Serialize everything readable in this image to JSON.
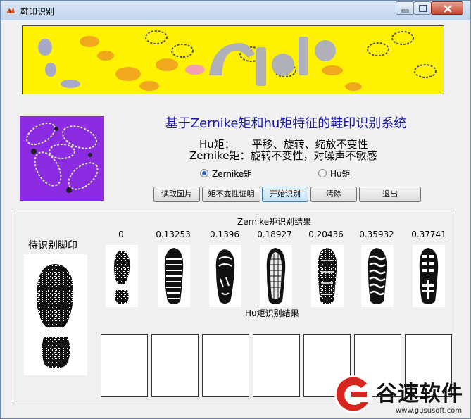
{
  "window": {
    "title": "鞋印识别"
  },
  "header": {
    "system_title": "基于Zernike矩和hu矩特征的鞋印识别系统",
    "desc_hu": "Hu矩：     平移、旋转、缩放不变性",
    "desc_zernike": "Zernike矩：旋转不变性，对噪声不敏感"
  },
  "options": {
    "zernike_label": "Zernike矩",
    "hu_label": "Hu矩",
    "selected": "Zernike矩"
  },
  "buttons": [
    {
      "label": "读取图片"
    },
    {
      "label": "矩不变性证明"
    },
    {
      "label": "开始识别"
    },
    {
      "label": "清除"
    },
    {
      "label": "退出"
    }
  ],
  "results": {
    "zernike_title": "Zernike矩识别结果",
    "hu_title": "Hu矩识别结果",
    "query_label": "待识别脚印",
    "zernike_scores": [
      "0",
      "0.13253",
      "0.1396",
      "0.18927",
      "0.20436",
      "0.35932",
      "0.37741"
    ]
  },
  "watermark": {
    "text": "谷速软件",
    "url": "www.gususoft.com"
  },
  "colors": {
    "banner_bg": "#fff200",
    "thumb_bg": "#8b2be2",
    "title_blue": "#1a1aa6",
    "watermark_red": "#d7261e"
  }
}
